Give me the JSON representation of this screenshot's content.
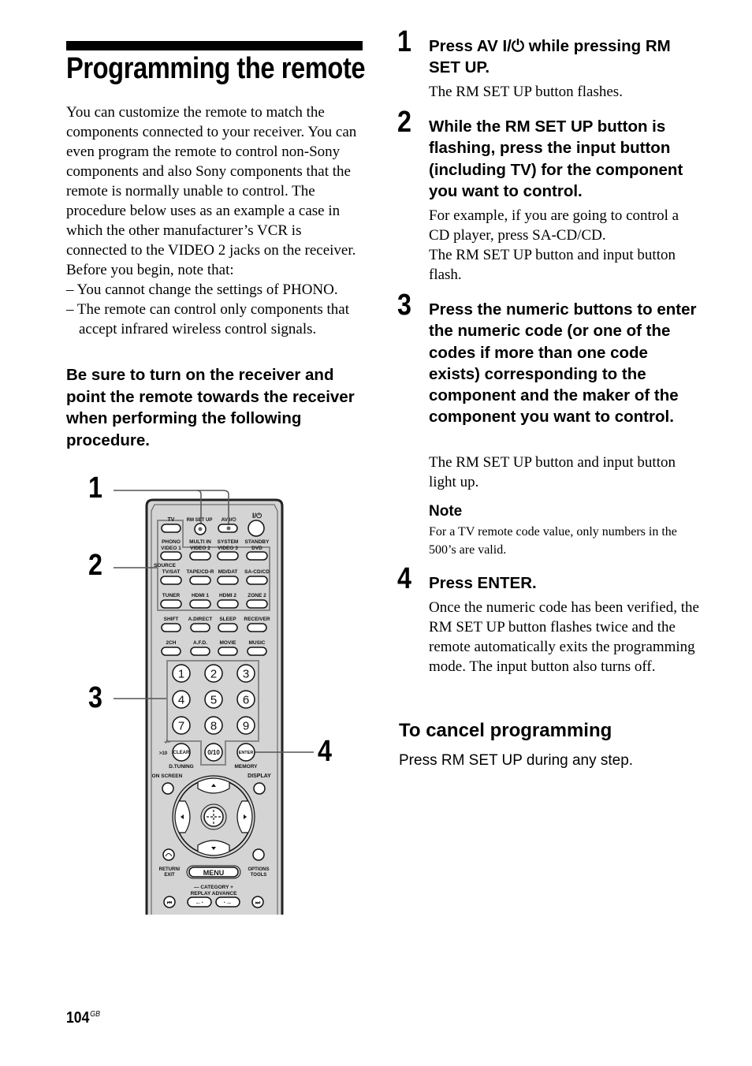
{
  "page": {
    "title": "Programming the remote",
    "page_number": "104",
    "page_suffix": "GB"
  },
  "intro": {
    "paragraph": "You can customize the remote to match the components connected to your receiver. You can even program the remote to control non-Sony components and also Sony components that the remote is normally unable to control. The procedure below uses as an example a case in which the other manufacturer’s VCR is connected to the VIDEO 2 jacks on the receiver.",
    "before_begin": "Before you begin, note that:",
    "bullets": [
      "– You cannot change the settings of PHONO.",
      "– The remote can control only components that accept infrared wireless control signals."
    ]
  },
  "warning": "Be sure to turn on the receiver and point the remote towards the receiver when performing the following procedure.",
  "steps": [
    {
      "number": "1",
      "heading": "Press AV I/⏻ while pressing RM SET UP.",
      "body": [
        "The RM SET UP button flashes."
      ]
    },
    {
      "number": "2",
      "heading": "While the RM SET UP button is flashing, press the input button (including TV) for the component you want to control.",
      "body": [
        "For example, if you are going to control a CD player, press SA-CD/CD.",
        "The RM SET UP button and input button flash."
      ]
    },
    {
      "number": "3",
      "heading": "Press the numeric buttons to enter the numeric code (or one of the codes if more than one code exists) corresponding to the component and the maker of the component you want to control.",
      "body": [
        "The RM SET UP button and input button light up."
      ]
    },
    {
      "number": "4",
      "heading": "Press ENTER.",
      "body": [
        "Once the numeric code has been verified, the RM SET UP button flashes twice and the remote automatically exits the programming mode. The input button also turns off."
      ]
    }
  ],
  "note": {
    "title": "Note",
    "text": "For a TV remote code value, only numbers in the 500’s are valid."
  },
  "cancel": {
    "title": "To cancel programming",
    "text": "Press RM SET UP during any step."
  },
  "figure": {
    "callouts": [
      "1",
      "2",
      "3",
      "4"
    ],
    "remote": {
      "top_labels": [
        "TV",
        "RM SET UP",
        "AV I/⏻",
        "I/⏻"
      ],
      "row1_labels": [
        [
          "PHONO",
          "VIDEO 1"
        ],
        [
          "MULTI IN",
          "VIDEO 2"
        ],
        [
          "SYSTEM",
          "VIDEO 3"
        ],
        [
          "STANDBY",
          "DVD"
        ]
      ],
      "row2_labels": [
        [
          "SOURCE",
          "TV/SAT"
        ],
        [
          "",
          "TAPE/CD-R"
        ],
        [
          "",
          "MD/DAT"
        ],
        [
          "",
          "SA-CD/CD"
        ]
      ],
      "row3_labels": [
        "TUNER",
        "HDMI 1",
        "HDMI 2",
        "ZONE 2"
      ],
      "row4_labels": [
        "SHIFT",
        "A.DIRECT",
        "SLEEP",
        "RECEIVER"
      ],
      "row5_labels": [
        "2CH",
        "A.F.D.",
        "MOVIE",
        "MUSIC"
      ],
      "digits": [
        "1",
        "2",
        "3",
        "4",
        "5",
        "6",
        "7",
        "8",
        "9"
      ],
      "clear": "CLEAR",
      "zero": "0/10",
      "enter": "ENTER",
      "gt10": ">10",
      "dash": "-/--",
      "d_tuning": "D.TUNING",
      "memory": "MEMORY",
      "on_screen": "ON SCREEN",
      "display": "DISPLAY",
      "return_exit": [
        "RETURN/",
        "EXIT"
      ],
      "menu": "MENU",
      "options_tools": [
        "OPTIONS",
        "TOOLS"
      ],
      "category": "— CATEGORY +",
      "replay_advance": "REPLAY  ADVANCE"
    }
  }
}
